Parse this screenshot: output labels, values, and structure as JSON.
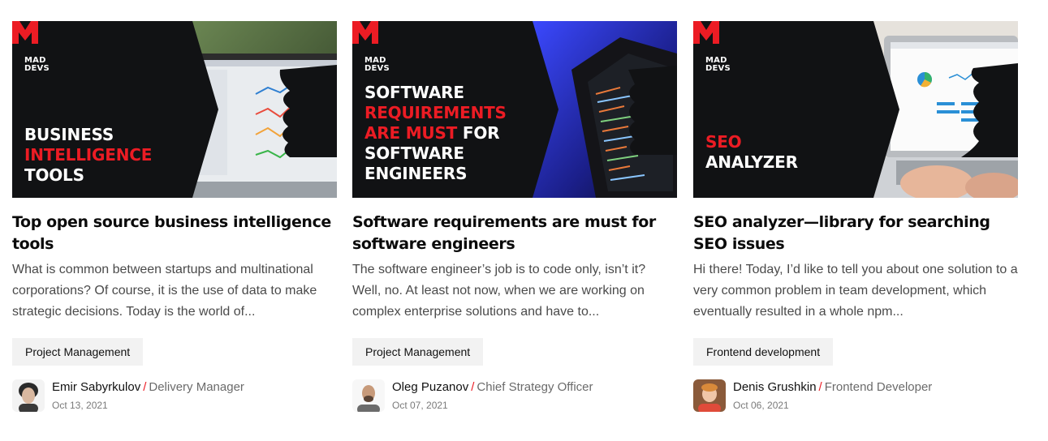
{
  "brand": {
    "logo_line1": "MAD",
    "logo_line2": "DEVS",
    "accent": "#ec1c24"
  },
  "posts": [
    {
      "cover_lines": [
        {
          "text": "BUSINESS",
          "accent": false
        },
        {
          "text": "INTELLIGENCE",
          "accent": true
        },
        {
          "text": "TOOLS",
          "accent": false
        }
      ],
      "title": "Top open source business intelligence tools",
      "excerpt": "What is common between startups and multinational corporations? Of course, it is the use of data to make strategic decisions. Today is the world of...",
      "tag": "Project Management",
      "author": "Emir Sabyrkulov",
      "separator": "/",
      "role": "Delivery Manager",
      "date": "Oct 13, 2021",
      "avatar_icon": "person-avatar-icon"
    },
    {
      "cover_lines": [
        {
          "text": "SOFTWARE",
          "accent": false
        },
        {
          "text": "REQUIREMENTS",
          "accent": true
        },
        {
          "text": "ARE MUST",
          "accent": true,
          "suffix": " FOR"
        },
        {
          "text": "SOFTWARE",
          "accent": false
        },
        {
          "text": "ENGINEERS",
          "accent": false
        }
      ],
      "title": "Software requirements are must for software engineers",
      "excerpt": "The software engineer’s job is to code only, isn’t it? Well, no. At least not now, when we are working on complex enterprise solutions and have to...",
      "tag": "Project Management",
      "author": "Oleg Puzanov",
      "separator": "/",
      "role": "Chief Strategy Officer",
      "date": "Oct 07, 2021",
      "avatar_icon": "person-avatar-icon"
    },
    {
      "cover_lines": [
        {
          "text": "SEO",
          "accent": true
        },
        {
          "text": "ANALYZER",
          "accent": false
        }
      ],
      "title": "SEO analyzer—library for searching SEO issues",
      "excerpt": "Hi there! Today, I’d like to tell you about one solution to a very common problem in team development, which eventually resulted in a whole npm...",
      "tag": "Frontend development",
      "author": "Denis Grushkin",
      "separator": "/",
      "role": "Frontend Developer",
      "date": "Oct 06, 2021",
      "avatar_icon": "person-avatar-icon"
    }
  ]
}
